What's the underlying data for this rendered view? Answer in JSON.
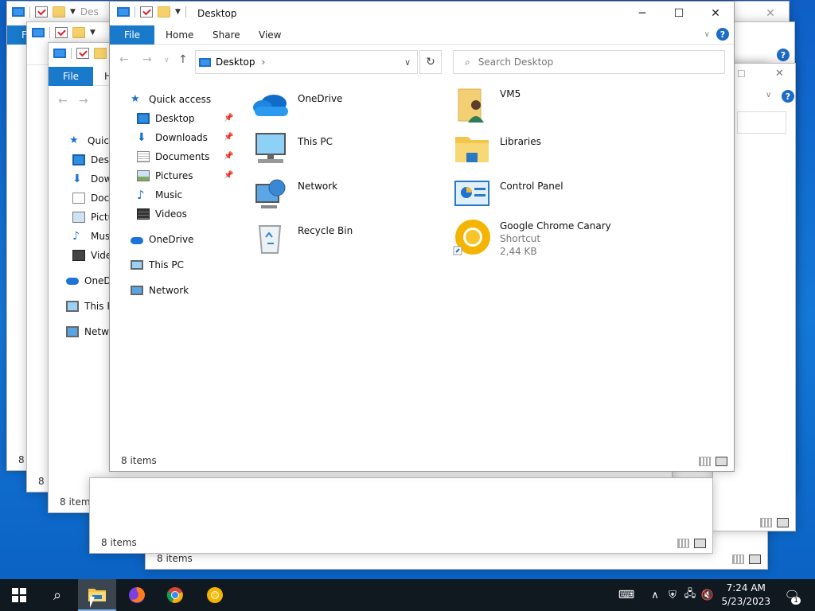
{
  "window": {
    "title": "Desktop",
    "title_short": "Des",
    "controls": {
      "minimize": "─",
      "maximize": "☐",
      "close": "✕"
    }
  },
  "ribbon": {
    "file": "File",
    "home": "Home",
    "home_short": "H",
    "share": "Share",
    "view": "View",
    "help": "?"
  },
  "address": {
    "location": "Desktop",
    "separator": "›",
    "search_placeholder": "Search Desktop"
  },
  "nav": {
    "quick_access": "Quick access",
    "quick_access_short": "Quick",
    "items": [
      {
        "label": "Desktop",
        "short": "Desk",
        "icon": "desktop-icon",
        "pinned": true
      },
      {
        "label": "Downloads",
        "short": "Dow",
        "icon": "downloads-icon",
        "pinned": true
      },
      {
        "label": "Documents",
        "short": "Docu",
        "icon": "documents-icon",
        "pinned": true
      },
      {
        "label": "Pictures",
        "short": "Pictu",
        "icon": "pictures-icon",
        "pinned": true
      },
      {
        "label": "Music",
        "short": "Mus",
        "icon": "music-icon",
        "pinned": false
      },
      {
        "label": "Videos",
        "short": "Vide",
        "icon": "videos-icon",
        "pinned": false
      }
    ],
    "onedrive": "OneDrive",
    "onedrive_short": "OneD",
    "this_pc": "This PC",
    "this_pc_short": "This P",
    "network": "Network",
    "network_short": "Netwo"
  },
  "content": {
    "items": [
      {
        "name": "OneDrive",
        "icon": "onedrive-cloud-icon"
      },
      {
        "name": "VM5",
        "icon": "user-folder-icon"
      },
      {
        "name": "This PC",
        "icon": "this-pc-icon"
      },
      {
        "name": "Libraries",
        "icon": "libraries-icon"
      },
      {
        "name": "Network",
        "icon": "network-icon"
      },
      {
        "name": "Control Panel",
        "icon": "control-panel-icon"
      },
      {
        "name": "Recycle Bin",
        "icon": "recycle-bin-icon"
      },
      {
        "name": "Google Chrome Canary",
        "type": "Shortcut",
        "size": "2,44 KB",
        "icon": "chrome-canary-icon"
      }
    ]
  },
  "status": {
    "items_count": "8 items",
    "items_count_short": "8 i"
  },
  "taskbar": {
    "time": "7:24 AM",
    "date": "5/23/2023",
    "notification_count": "1"
  },
  "colors": {
    "accent": "#1979ca",
    "desktop": "#0f6fd0",
    "taskbar": "#101820"
  }
}
